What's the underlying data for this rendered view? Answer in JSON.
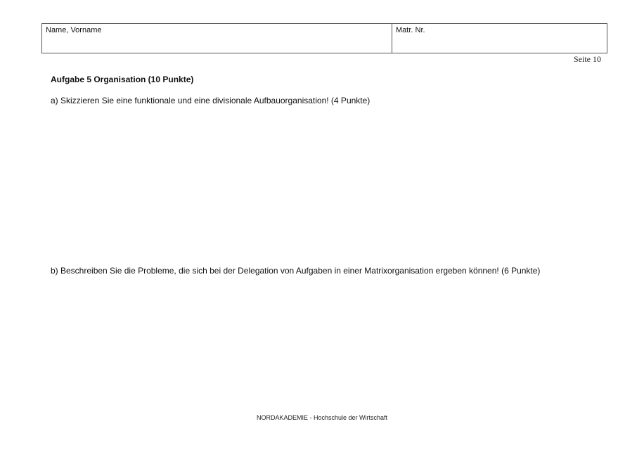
{
  "header": {
    "name_label": "Name, Vorname",
    "matr_label": "Matr. Nr."
  },
  "page_number": "Seite 10",
  "task": {
    "title": "Aufgabe 5 Organisation (10 Punkte)",
    "question_a": "a) Skizzieren Sie eine funktionale und eine divisionale Aufbauorganisation! (4 Punkte)",
    "question_b": "b) Beschreiben Sie die Probleme, die sich bei der Delegation von Aufgaben in einer Matrixorganisation ergeben können! (6 Punkte)"
  },
  "footer": "NORDAKADEMIE - Hochschule der Wirtschaft"
}
